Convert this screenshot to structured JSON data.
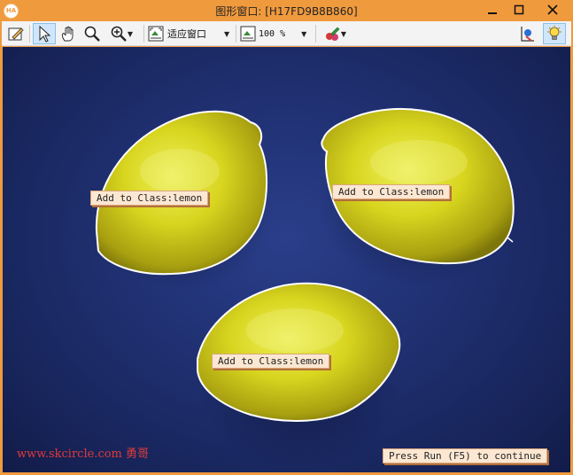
{
  "window": {
    "title": "图形窗口: [H17FD9B8B860]",
    "app_icon_text": "HA"
  },
  "toolbar": {
    "zoom_fit_label": "适应窗口",
    "zoom_percent_label": "100 %"
  },
  "canvas": {
    "object_labels": [
      "Add to Class:lemon",
      "Add to Class:lemon",
      "Add to Class:lemon"
    ],
    "status_hint": "Press Run (F5) to continue",
    "watermark": "www.skcircle.com 勇哥"
  },
  "colors": {
    "frame_orange": "#f09a3e",
    "toolbar_bg": "#f3f3f3",
    "canvas_navy": "#1f2f70",
    "lemon_yellow": "#d6d41e",
    "outline_white": "#ffffff",
    "label_bg": "#fbe7d2",
    "watermark_red": "#e23a3a"
  },
  "icons": [
    "edit-window-icon",
    "pointer-icon",
    "hand-pan-icon",
    "magnifier-icon",
    "zoom-in-icon",
    "fit-window-icon",
    "zoom-percent-icon",
    "color-palette-icon",
    "graphics-settings-icon",
    "lightbulb-icon"
  ]
}
